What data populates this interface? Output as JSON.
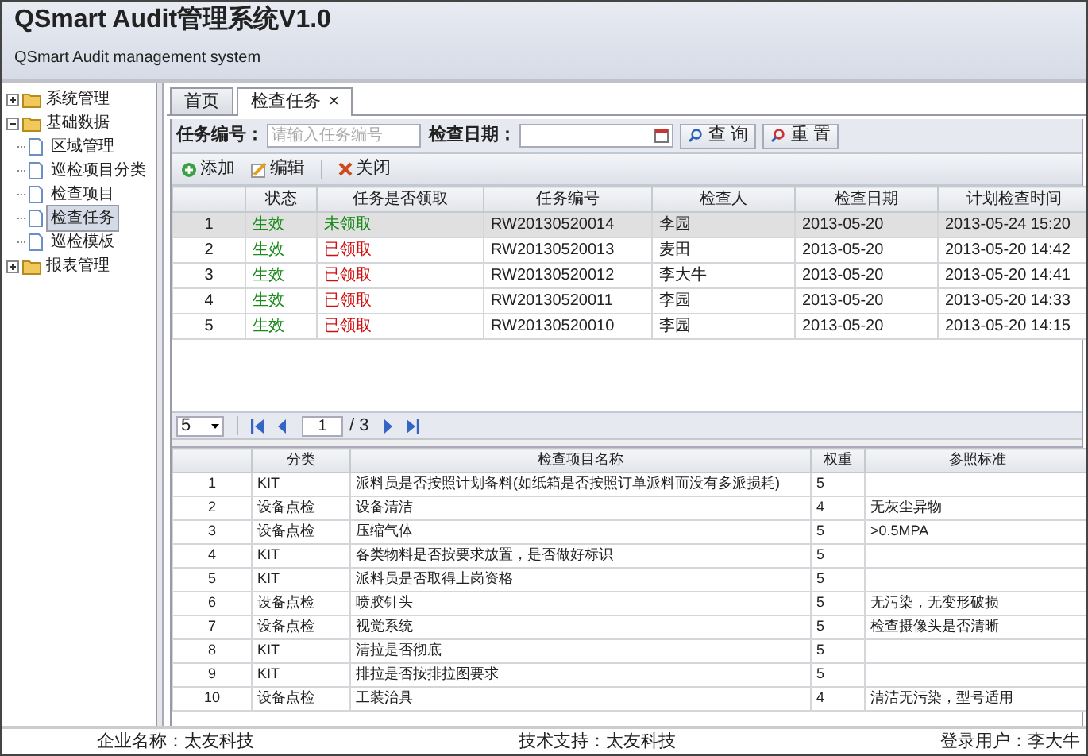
{
  "header": {
    "title": "QSmart Audit管理系统V1.0",
    "subtitle": "QSmart Audit management system"
  },
  "sidebar": {
    "items": [
      {
        "label": "系统管理",
        "expanded": false,
        "selected": false
      },
      {
        "label": "基础数据",
        "expanded": true,
        "selected": false,
        "children": [
          {
            "label": "区域管理",
            "selected": false
          },
          {
            "label": "巡检项目分类",
            "selected": false
          },
          {
            "label": "检查项目",
            "selected": false
          },
          {
            "label": "检查任务",
            "selected": true
          },
          {
            "label": "巡检模板",
            "selected": false
          }
        ]
      },
      {
        "label": "报表管理",
        "expanded": false,
        "selected": false
      }
    ]
  },
  "tabs": [
    {
      "label": "首页",
      "selected": false
    },
    {
      "label": "检查任务",
      "selected": true,
      "close": "×"
    }
  ],
  "search": {
    "task_no_label": "任务编号：",
    "task_no_placeholder": "请输入任务编号",
    "date_label": "检查日期：",
    "buttons": [
      "查 询",
      "重 置"
    ]
  },
  "toolbar": [
    {
      "label": "添加",
      "kind": "add"
    },
    {
      "label": "编辑",
      "kind": "edit"
    },
    {
      "label": "关闭",
      "kind": "close"
    }
  ],
  "tasks": {
    "columns": [
      "",
      "状态",
      "任务是否领取",
      "任务编号",
      "检查人",
      "检查日期",
      "计划检查时间"
    ],
    "rows": [
      {
        "index": "1",
        "status": "生效",
        "claim": "未领取",
        "claimed": false,
        "task_no": "RW20130520014",
        "inspector": "李园",
        "date": "2013-05-20",
        "planned": "2013-05-24 15:20",
        "selected": true
      },
      {
        "index": "2",
        "status": "生效",
        "claim": "已领取",
        "claimed": true,
        "task_no": "RW20130520013",
        "inspector": "麦田",
        "date": "2013-05-20",
        "planned": "2013-05-20 14:42",
        "selected": false
      },
      {
        "index": "3",
        "status": "生效",
        "claim": "已领取",
        "claimed": true,
        "task_no": "RW20130520012",
        "inspector": "李大牛",
        "date": "2013-05-20",
        "planned": "2013-05-20 14:41",
        "selected": false
      },
      {
        "index": "4",
        "status": "生效",
        "claim": "已领取",
        "claimed": true,
        "task_no": "RW20130520011",
        "inspector": "李园",
        "date": "2013-05-20",
        "planned": "2013-05-20 14:33",
        "selected": false
      },
      {
        "index": "5",
        "status": "生效",
        "claim": "已领取",
        "claimed": true,
        "task_no": "RW20130520010",
        "inspector": "李园",
        "date": "2013-05-20",
        "planned": "2013-05-20 14:15",
        "selected": false
      }
    ]
  },
  "pager": {
    "page_size": "5",
    "page": "1",
    "total": "/ 3"
  },
  "items": {
    "columns": [
      "",
      "分类",
      "检查项目名称",
      "权重",
      "参照标准"
    ],
    "rows": [
      [
        "1",
        "KIT",
        "派料员是否按照计划备料(如纸箱是否按照订单派料而没有多派损耗)",
        "5",
        ""
      ],
      [
        "2",
        "设备点检",
        "设备清洁",
        "4",
        "无灰尘异物"
      ],
      [
        "3",
        "设备点检",
        "压缩气体",
        "5",
        ">0.5MPA"
      ],
      [
        "4",
        "KIT",
        "各类物料是否按要求放置，是否做好标识",
        "5",
        ""
      ],
      [
        "5",
        "KIT",
        "派料员是否取得上岗资格",
        "5",
        ""
      ],
      [
        "6",
        "设备点检",
        "喷胶针头",
        "5",
        "无污染，无变形破损"
      ],
      [
        "7",
        "设备点检",
        "视觉系统",
        "5",
        "检查摄像头是否清晰"
      ],
      [
        "8",
        "KIT",
        "清拉是否彻底",
        "5",
        ""
      ],
      [
        "9",
        "KIT",
        "排拉是否按排拉图要求",
        "5",
        ""
      ],
      [
        "10",
        "设备点检",
        "工装治具",
        "4",
        "清洁无污染，型号适用"
      ]
    ]
  },
  "footer": [
    "企业名称：太友科技",
    "技术支持：太友科技",
    "登录用户：李大牛"
  ]
}
